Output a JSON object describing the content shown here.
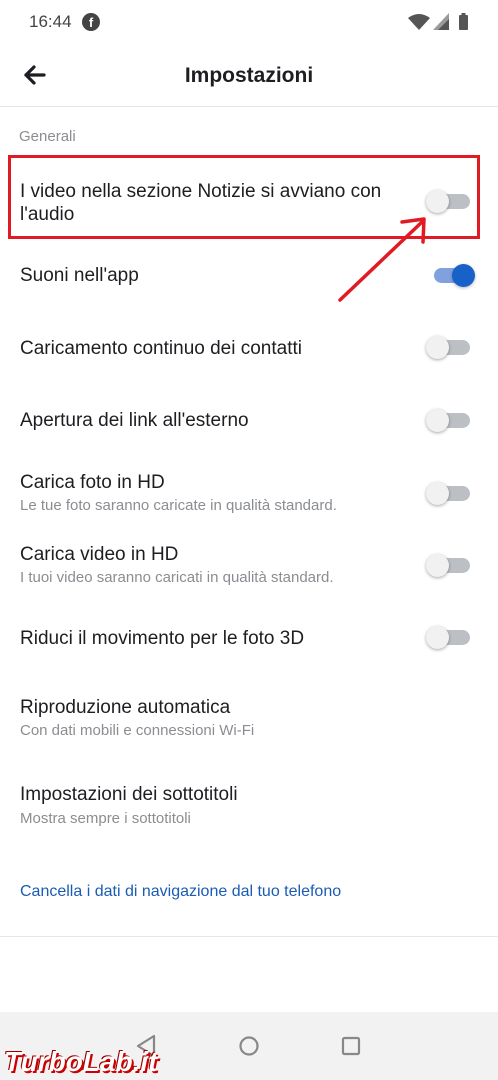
{
  "status": {
    "time": "16:44",
    "fb_glyph": "f"
  },
  "header": {
    "title": "Impostazioni"
  },
  "section": {
    "label": "Generali"
  },
  "rows": [
    {
      "title": "I video nella sezione Notizie si avviano con l'audio",
      "on": false
    },
    {
      "title": "Suoni nell'app",
      "on": true
    },
    {
      "title": "Caricamento continuo dei contatti",
      "on": false
    },
    {
      "title": "Apertura dei link all'esterno",
      "on": false
    },
    {
      "title": "Carica foto in HD",
      "subtitle": "Le tue foto saranno caricate in qualità standard.",
      "on": false
    },
    {
      "title": "Carica video in HD",
      "subtitle": "I tuoi video saranno caricati in qualità standard.",
      "on": false
    },
    {
      "title": "Riduci il movimento per le foto 3D",
      "on": false
    }
  ],
  "plain_rows": [
    {
      "title": "Riproduzione automatica",
      "subtitle": "Con dati mobili e connessioni Wi-Fi"
    },
    {
      "title": "Impostazioni dei sottotitoli",
      "subtitle": "Mostra sempre i sottotitoli"
    }
  ],
  "link": {
    "label": "Cancella i dati di navigazione dal tuo telefono"
  },
  "watermark": {
    "text": "TurboLab.it"
  },
  "colors": {
    "accent": "#1761c9",
    "highlight": "#e01b24",
    "link": "#1a5cb4"
  }
}
